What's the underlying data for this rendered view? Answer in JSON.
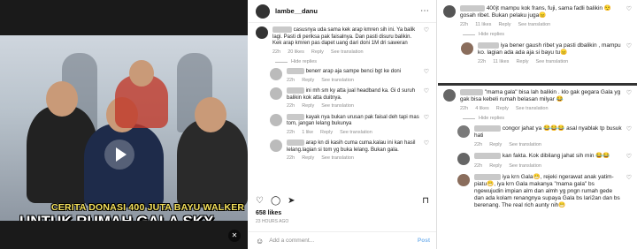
{
  "video": {
    "caption_line1": "CERITA DONASI 400 JUTA BAYU WALKER",
    "caption_line2": "UNTUK RUMAH GALA SKY",
    "volume_icon": "mute-icon"
  },
  "post": {
    "username": "lambe__danu",
    "more_icon": "⋯",
    "comments": [
      {
        "text": "casusnya uda sama kek arap kmren sih ini. Ya balik lagi. Pasti di periksa pak faisalnya. Dan pasti disuru balikin. Kek arap kmren pas dapet uang dari doni 1M dri saweran",
        "time": "22h",
        "likes": "20 likes",
        "reply": "Reply",
        "translate": "See translation"
      },
      {
        "hide": "Hide replies"
      },
      {
        "text": "benerr arap aja sampe benci bgt ke doni",
        "time": "22h",
        "likes": "",
        "reply": "Reply",
        "translate": "See translation",
        "reply_level": true
      },
      {
        "text": "ini mh sm ky atta jual headband ka. Gi d suruh balikin kok atta duitnya.",
        "time": "22h",
        "likes": "",
        "reply": "Reply",
        "translate": "See translation",
        "reply_level": true
      },
      {
        "text": "kayak nya bukan urusan pak faisal deh tapi mas tom, jangan lelang bukunya",
        "time": "22h",
        "likes": "1 like",
        "reply": "Reply",
        "translate": "See translation",
        "reply_level": true
      },
      {
        "text": "arap kn di kasih cuma cuma.kalau ini kan hasil lelang.lagian si tom yg buka lelang. Bukan gala.",
        "time": "22h",
        "likes": "",
        "reply": "Reply",
        "translate": "See translation",
        "reply_level": true
      }
    ],
    "likes": "658 likes",
    "ago": "23 HOURS AGO",
    "add_placeholder": "Add a comment...",
    "post_label": "Post"
  },
  "right_top": {
    "comments": [
      {
        "text": "400jt mampu kok frans, fuji, sama fadli balikin 😌 gosah ribet. Bukan pelaku juga😑",
        "time": "22h",
        "likes": "11 likes",
        "reply": "Reply",
        "translate": "See translation"
      },
      {
        "hide": "Hide replies"
      },
      {
        "text": "iya bener gaush ribet ya pasti dbalikin , mampu ko. lagian ada ada aja si bayu tu😑",
        "time": "22h",
        "likes": "11 likes",
        "reply": "Reply",
        "translate": "See translation"
      }
    ]
  },
  "right_bottom": {
    "comments": [
      {
        "text": "\"mama gala\" bisa lah balikin . klo gak gegara Gala yg gak bisa kebeli rumah belasan milyar 😂",
        "time": "22h",
        "likes": "4 likes",
        "reply": "Reply",
        "translate": "See translation"
      },
      {
        "hide": "Hide replies"
      },
      {
        "text": "congor jahat ya 😂😂😂 asal nyablak tp busuk hati",
        "time": "22h",
        "likes": "",
        "reply": "Reply",
        "translate": "See translation"
      },
      {
        "text": "kan fakta. Kok dibilang jahat sih min 😂😂",
        "time": "22h",
        "likes": "",
        "reply": "Reply",
        "translate": "See translation"
      },
      {
        "text": "iya krn Gala😁, rejeki ngerawat anak yatim-piatu😁, iya krn Gala makanya \"mama gala\" bs ngewujudin impian alm dan almh yg pngn rumah gede dan ada kolam renangnya supaya Gala bs lari2an dan bs berenang. The real rich aunty nih😁",
        "time": "22h",
        "likes": "",
        "reply": "",
        "translate": ""
      }
    ]
  },
  "colors": {
    "accent": "#0095f6",
    "muted": "#8e8e8e"
  }
}
